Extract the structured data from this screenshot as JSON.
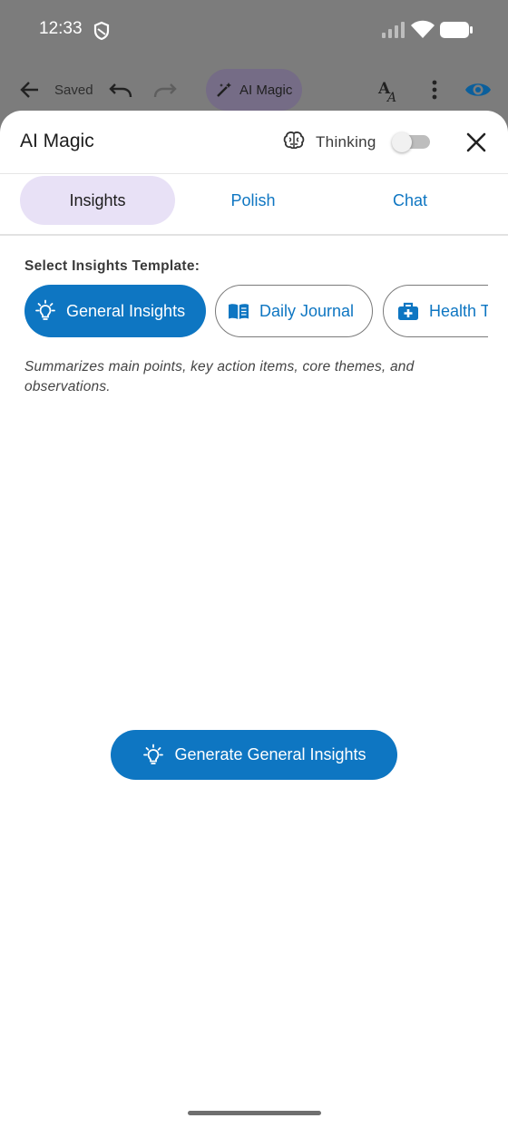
{
  "status_bar": {
    "time": "12:33"
  },
  "background_toolbar": {
    "saved_label": "Saved",
    "ai_magic_label": "AI Magic"
  },
  "sheet": {
    "title": "AI Magic",
    "thinking_label": "Thinking",
    "thinking_enabled": false,
    "tabs": [
      {
        "label": "Insights",
        "selected": true
      },
      {
        "label": "Polish",
        "selected": false
      },
      {
        "label": "Chat",
        "selected": false
      }
    ],
    "template_label": "Select Insights Template:",
    "templates": [
      {
        "label": "General Insights",
        "icon": "lightbulb-icon",
        "selected": true
      },
      {
        "label": "Daily Journal",
        "icon": "book-icon",
        "selected": false
      },
      {
        "label": "Health Tracker",
        "icon": "medical-kit-icon",
        "selected": false
      }
    ],
    "description": "Summarizes main points, key action items, core themes, and observations.",
    "generate_label": "Generate General Insights"
  },
  "colors": {
    "accent": "#0e76c2",
    "selected_tab_bg": "#e8e1f6",
    "scrim": "#7c7c7c"
  }
}
